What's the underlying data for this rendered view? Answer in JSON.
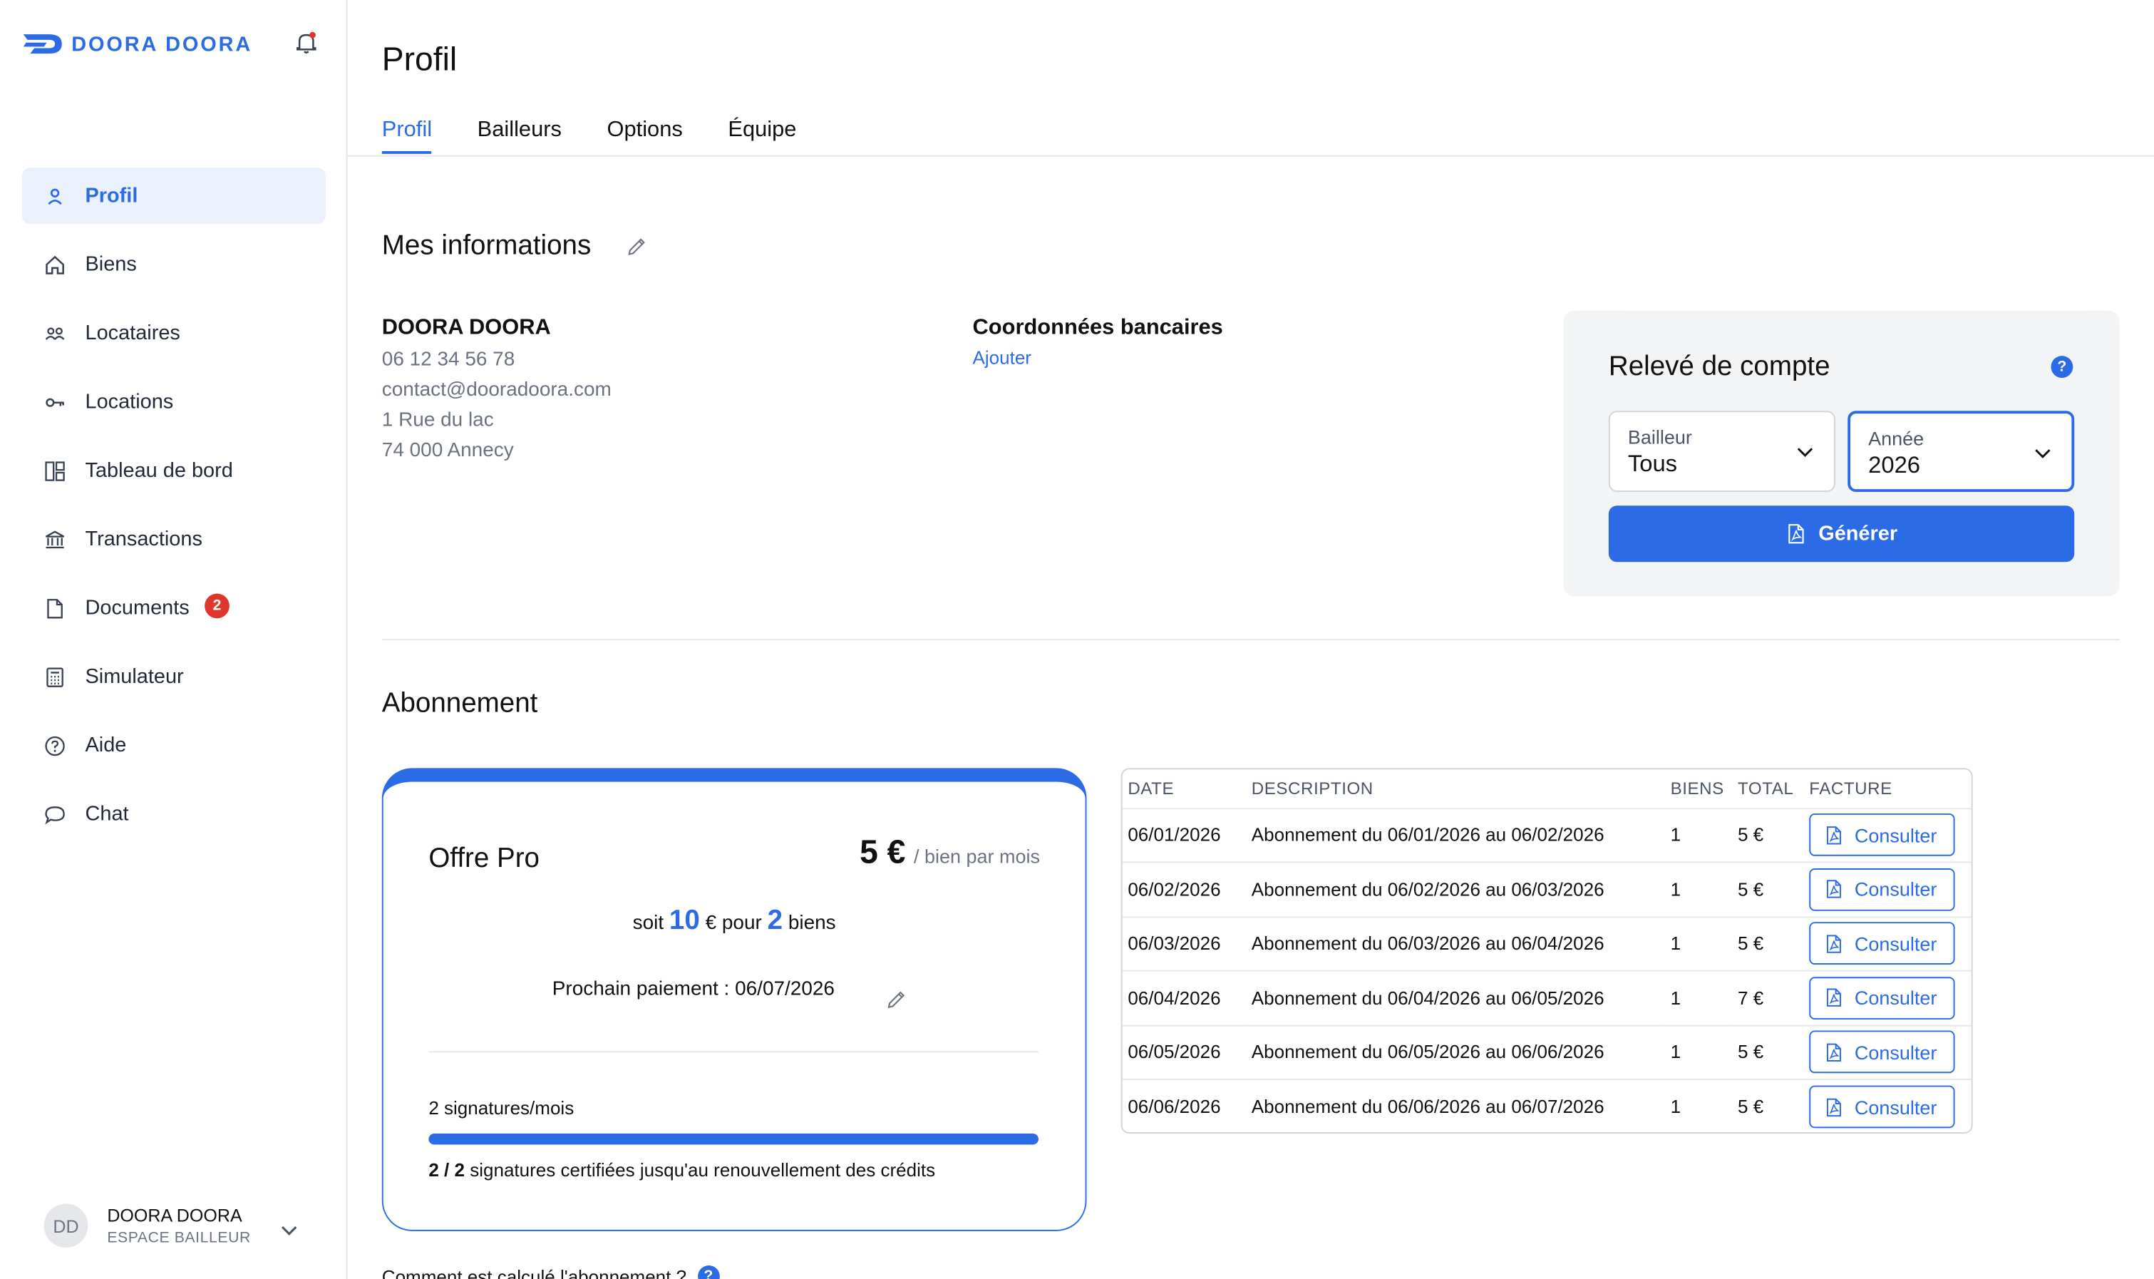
{
  "brand": {
    "name": "DOORA DOORA",
    "accent": "#2b6be6"
  },
  "sidebar": {
    "items": [
      {
        "label": "Profil",
        "icon": "user-icon",
        "active": true
      },
      {
        "label": "Biens",
        "icon": "home-icon"
      },
      {
        "label": "Locataires",
        "icon": "users-icon"
      },
      {
        "label": "Locations",
        "icon": "key-icon"
      },
      {
        "label": "Tableau de bord",
        "icon": "dashboard-icon"
      },
      {
        "label": "Transactions",
        "icon": "bank-icon"
      },
      {
        "label": "Documents",
        "icon": "file-icon",
        "badge": "2"
      },
      {
        "label": "Simulateur",
        "icon": "calculator-icon"
      },
      {
        "label": "Aide",
        "icon": "help-circle-icon"
      },
      {
        "label": "Chat",
        "icon": "chat-icon"
      }
    ],
    "user": {
      "initials": "DD",
      "name": "DOORA DOORA",
      "role": "ESPACE BAILLEUR"
    }
  },
  "page": {
    "title": "Profil",
    "tabs": [
      "Profil",
      "Bailleurs",
      "Options",
      "Équipe"
    ]
  },
  "info": {
    "section_title": "Mes informations",
    "name": "DOORA DOORA",
    "phone": "06 12 34 56 78",
    "email": "contact@dooradoora.com",
    "address1": "1 Rue du lac",
    "address2": "74 000 Annecy",
    "bank_title": "Coordonnées bancaires",
    "bank_link": "Ajouter"
  },
  "releve": {
    "title": "Relevé de compte",
    "help": "?",
    "bailleur_label": "Bailleur",
    "bailleur_value": "Tous",
    "annee_label": "Année",
    "annee_value": "2026",
    "button": "Générer"
  },
  "abonnement": {
    "section_title": "Abonnement",
    "offer_name": "Offre Pro",
    "price": "5 €",
    "price_unit": "/ bien par mois",
    "soit_prefix": "soit",
    "soit_total": "10",
    "soit_mid": "€ pour",
    "soit_count": "2",
    "soit_suffix": "biens",
    "next_payment": "Prochain paiement : 06/07/2026",
    "signatures": "2 signatures/mois",
    "signatures_used_fraction": 1.0,
    "credits_count": "2 / 2",
    "credits_text": "signatures certifiées jusqu'au renouvellement des crédits",
    "footer_question": "Comment est calculé l'abonnement ?"
  },
  "invoices": {
    "headers": [
      "DATE",
      "DESCRIPTION",
      "BIENS",
      "TOTAL",
      "FACTURE"
    ],
    "button_label": "Consulter",
    "rows": [
      {
        "date": "06/01/2026",
        "description": "Abonnement du 06/01/2026 au 06/02/2026",
        "biens": "1",
        "total": "5 €"
      },
      {
        "date": "06/02/2026",
        "description": "Abonnement du 06/02/2026 au 06/03/2026",
        "biens": "1",
        "total": "5 €"
      },
      {
        "date": "06/03/2026",
        "description": "Abonnement du 06/03/2026 au 06/04/2026",
        "biens": "1",
        "total": "5 €"
      },
      {
        "date": "06/04/2026",
        "description": "Abonnement du 06/04/2026 au 06/05/2026",
        "biens": "1",
        "total": "7 €"
      },
      {
        "date": "06/05/2026",
        "description": "Abonnement du 06/05/2026 au 06/06/2026",
        "biens": "1",
        "total": "5 €"
      },
      {
        "date": "06/06/2026",
        "description": "Abonnement du 06/06/2026 au 06/07/2026",
        "biens": "1",
        "total": "5 €"
      }
    ]
  }
}
